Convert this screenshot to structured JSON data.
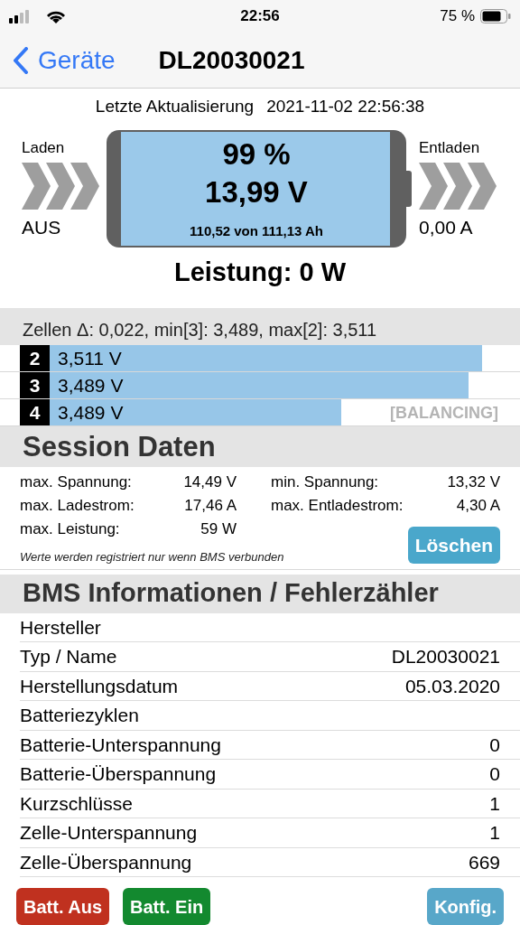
{
  "status_bar": {
    "time": "22:56",
    "battery_text": "75 %"
  },
  "nav": {
    "back": "Geräte",
    "title": "DL20030021"
  },
  "update": {
    "label": "Letzte Aktualisierung",
    "value": "2021-11-02 22:56:38"
  },
  "charge": {
    "label": "Laden",
    "value": "AUS"
  },
  "discharge": {
    "label": "Entladen",
    "value": "0,00 A"
  },
  "battery": {
    "percent": "99 %",
    "voltage": "13,99 V",
    "capacity": "110,52 von 111,13 Ah"
  },
  "power": "Leistung: 0 W",
  "cells": {
    "header": "Zellen Δ: 0,022, min[3]: 3,489, max[2]: 3,511",
    "items": [
      {
        "index": "2",
        "voltage": "3,511 V",
        "level": 0.92
      },
      {
        "index": "3",
        "voltage": "3,489 V",
        "level": 0.89
      },
      {
        "index": "4",
        "voltage": "3,489 V",
        "level": 0.62,
        "status": "[BALANCING]"
      }
    ]
  },
  "session": {
    "title": "Session Daten",
    "stats": [
      {
        "label": "max. Spannung:",
        "value": "14,49 V"
      },
      {
        "label": "min. Spannung:",
        "value": "13,32 V"
      },
      {
        "label": "max. Ladestrom:",
        "value": "17,46 A"
      },
      {
        "label": "max. Entladestrom:",
        "value": "4,30 A"
      },
      {
        "label": "max. Leistung:",
        "value": "59 W"
      }
    ],
    "note": "Werte werden registriert nur wenn BMS verbunden",
    "clear_button": "Löschen"
  },
  "bms": {
    "title": "BMS Informationen / Fehlerzähler",
    "rows": [
      {
        "label": "Hersteller"
      },
      {
        "label": "Typ / Name",
        "value": "DL20030021"
      },
      {
        "label": "Herstellungsdatum",
        "value": "05.03.2020"
      },
      {
        "label": "Batteriezyklen"
      },
      {
        "label": "Batterie-Unterspannung",
        "value": "0"
      },
      {
        "label": "Batterie-Überspannung",
        "value": "0"
      },
      {
        "label": "Kurzschlüsse",
        "value": "1"
      },
      {
        "label": "Zelle-Unterspannung",
        "value": "1"
      },
      {
        "label": "Zelle-Überspannung",
        "value": "669"
      }
    ]
  },
  "buttons": [
    {
      "label": "Batt. Aus",
      "kind": "danger"
    },
    {
      "label": "Batt. Ein",
      "kind": "success"
    },
    {
      "label": "Konfig.",
      "kind": "info"
    }
  ]
}
